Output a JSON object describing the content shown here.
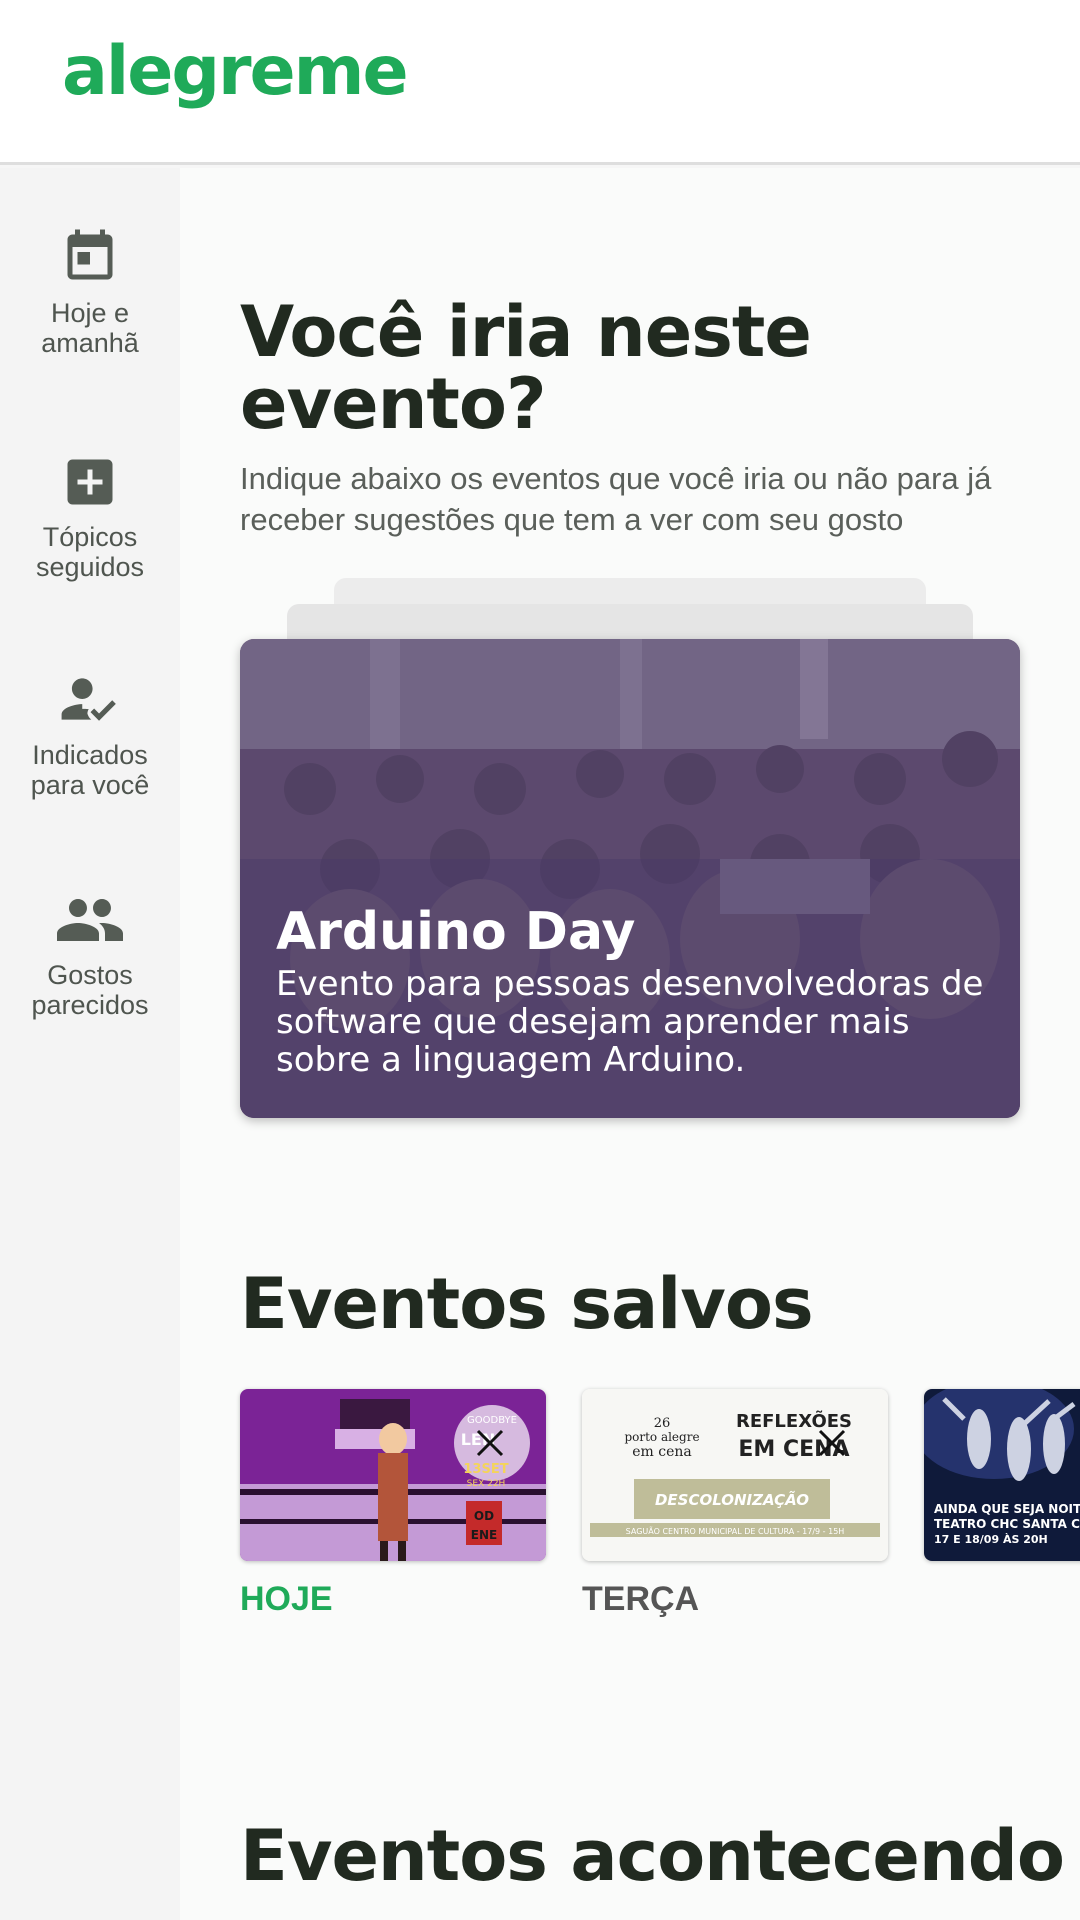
{
  "app": {
    "logo": "alegreme",
    "brand_color": "#1faa59"
  },
  "sidebar": {
    "items": [
      {
        "label": "Hoje e amanhã",
        "icon": "calendar-icon"
      },
      {
        "label": "Tópicos seguidos",
        "icon": "add-box-icon"
      },
      {
        "label": "Indicados para você",
        "icon": "person-check-icon"
      },
      {
        "label": "Gostos parecidos",
        "icon": "people-icon"
      }
    ]
  },
  "suggestion": {
    "title": "Você iria neste evento?",
    "subtitle": "Indique abaixo os eventos que você iria ou não para já receber sugestões que tem a ver com seu gosto",
    "card": {
      "title": "Arduino Day",
      "description": "Evento para pessoas desenvolvedoras de software que desejam aprender mais sobre a linguagem Arduino."
    }
  },
  "saved_events": {
    "title": "Eventos salvos",
    "items": [
      {
        "day": "HOJE",
        "day_color": "#1faa59",
        "poster_text": [
          "GOODBYE",
          "LEN",
          "13SET",
          "SEX 22H",
          "OD",
          "ENE"
        ]
      },
      {
        "day": "TERÇA",
        "day_color": "#555555",
        "poster_text": [
          "26",
          "porto alegre",
          "em cena",
          "REFLEXÕES",
          "EM CENA",
          "DESCOLONIZAÇÃO",
          "SAGUÃO CENTRO MUNICIPAL DE CULTURA - 17/9 - 15H"
        ]
      },
      {
        "day": "",
        "day_color": "#555555",
        "poster_text": [
          "AINDA QUE SEJA NOITE",
          "TEATRO CHC SANTA CASA",
          "17 E 18/09 ÀS 20H"
        ]
      }
    ]
  },
  "next_section": {
    "title": "Eventos acontecendo hoje"
  }
}
